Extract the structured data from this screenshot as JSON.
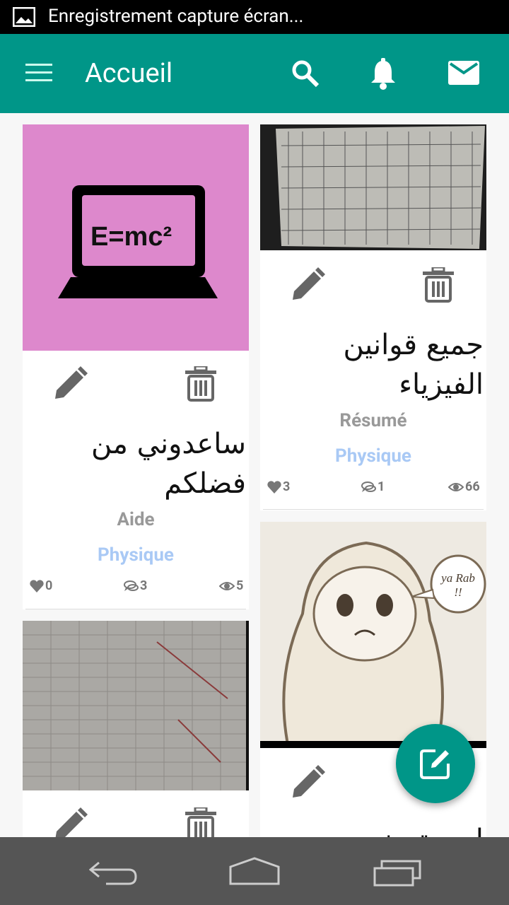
{
  "status_bar": {
    "notification_text": "Enregistrement capture écran..."
  },
  "app_bar": {
    "title": "Accueil",
    "icons": [
      "menu-icon",
      "search-icon",
      "bell-icon",
      "mail-icon"
    ]
  },
  "cards": [
    {
      "title_line1": "ساعدوني من",
      "title_line2": "فضلكم",
      "image_text": "E=mc²",
      "category": "Aide",
      "subject": "Physique",
      "likes": "0",
      "comments": "3",
      "views": "5"
    },
    {
      "title_line1": "جميع قوانين",
      "title_line2": "الفيزياء",
      "category": "Résumé",
      "subject": "Physique",
      "likes": "3",
      "comments": "1",
      "views": "66"
    },
    {
      "image_text": "ya Rab !!",
      "title_partial": "لمن تم نحم"
    },
    {}
  ],
  "colors": {
    "primary": "#009688",
    "image_bg_pink": "#dd88cc",
    "subject": "#a9c9f5",
    "category": "#999999"
  }
}
